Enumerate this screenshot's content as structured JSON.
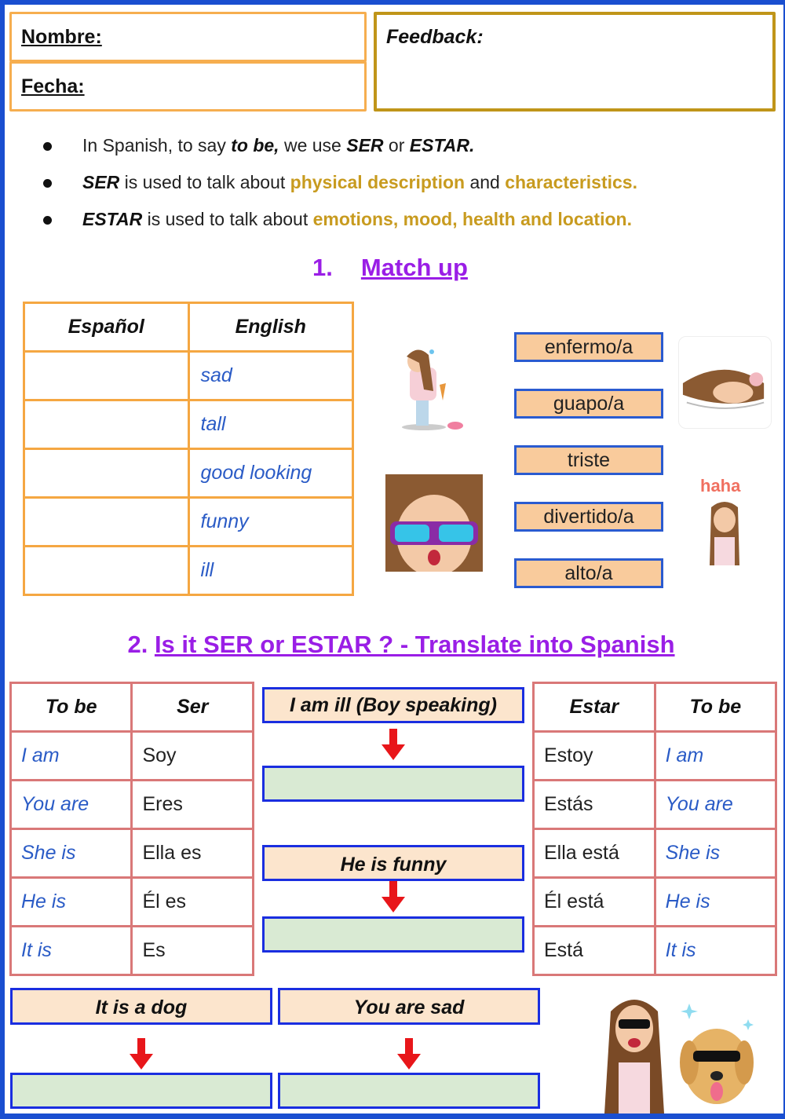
{
  "header": {
    "name_label": "Nombre:",
    "date_label": "Fecha:",
    "feedback_label": "Feedback:"
  },
  "intro": {
    "line1": {
      "a": "In Spanish, to say ",
      "b": "to be,",
      "c": " we use ",
      "d": "SER",
      "e": " or ",
      "f": "ESTAR."
    },
    "line2": {
      "a": "SER",
      "b": " is used to talk about ",
      "c": "physical description",
      "d": " and ",
      "e": "characteristics."
    },
    "line3": {
      "a": "ESTAR",
      "b": " is used to talk about ",
      "c": "emotions, mood, health and location."
    }
  },
  "section1": {
    "number": "1.",
    "title": "Match up",
    "table": {
      "headers": [
        "Español",
        "English"
      ],
      "rows": [
        {
          "es": "",
          "en": "sad"
        },
        {
          "es": "",
          "en": "tall"
        },
        {
          "es": "",
          "en": "good looking"
        },
        {
          "es": "",
          "en": "funny"
        },
        {
          "es": "",
          "en": "ill"
        }
      ]
    },
    "word_bank": [
      "enfermo/a",
      "guapo/a",
      "triste",
      "divertido/a",
      "alto/a"
    ],
    "stickers": [
      "crying-girl-sticker",
      "sick-in-bed-sticker",
      "lookin-good-sticker",
      "haha-sticker"
    ],
    "haha_text": "haha"
  },
  "section2": {
    "number": "2.",
    "title": "Is it SER or ESTAR ? - Translate into Spanish",
    "ser_table": {
      "headers": [
        "To be",
        "Ser"
      ],
      "rows": [
        [
          "I am",
          "Soy"
        ],
        [
          "You are",
          "Eres"
        ],
        [
          "She is",
          "Ella es"
        ],
        [
          "He is",
          "Él es"
        ],
        [
          "It is",
          "Es"
        ]
      ]
    },
    "estar_table": {
      "headers": [
        "Estar",
        "To be"
      ],
      "rows": [
        [
          "Estoy",
          "I am"
        ],
        [
          "Estás",
          "You are"
        ],
        [
          "Ella está",
          "She is"
        ],
        [
          "Él está",
          "He is"
        ],
        [
          "Está",
          "It is"
        ]
      ]
    },
    "prompts": [
      {
        "text": "I am ill (Boy speaking)",
        "answer": ""
      },
      {
        "text": "He is funny",
        "answer": ""
      },
      {
        "text": "It is a dog",
        "answer": ""
      },
      {
        "text": "You are sad",
        "answer": ""
      }
    ]
  },
  "colors": {
    "frame": "#1a4fd0",
    "title_purple": "#9a1ee6",
    "highlight_gold": "#c89b1f",
    "english_blue": "#2a5bc6",
    "chip_fill": "#f9cb9c",
    "answer_fill": "#d9ead3",
    "arrow_red": "#e8161a"
  }
}
